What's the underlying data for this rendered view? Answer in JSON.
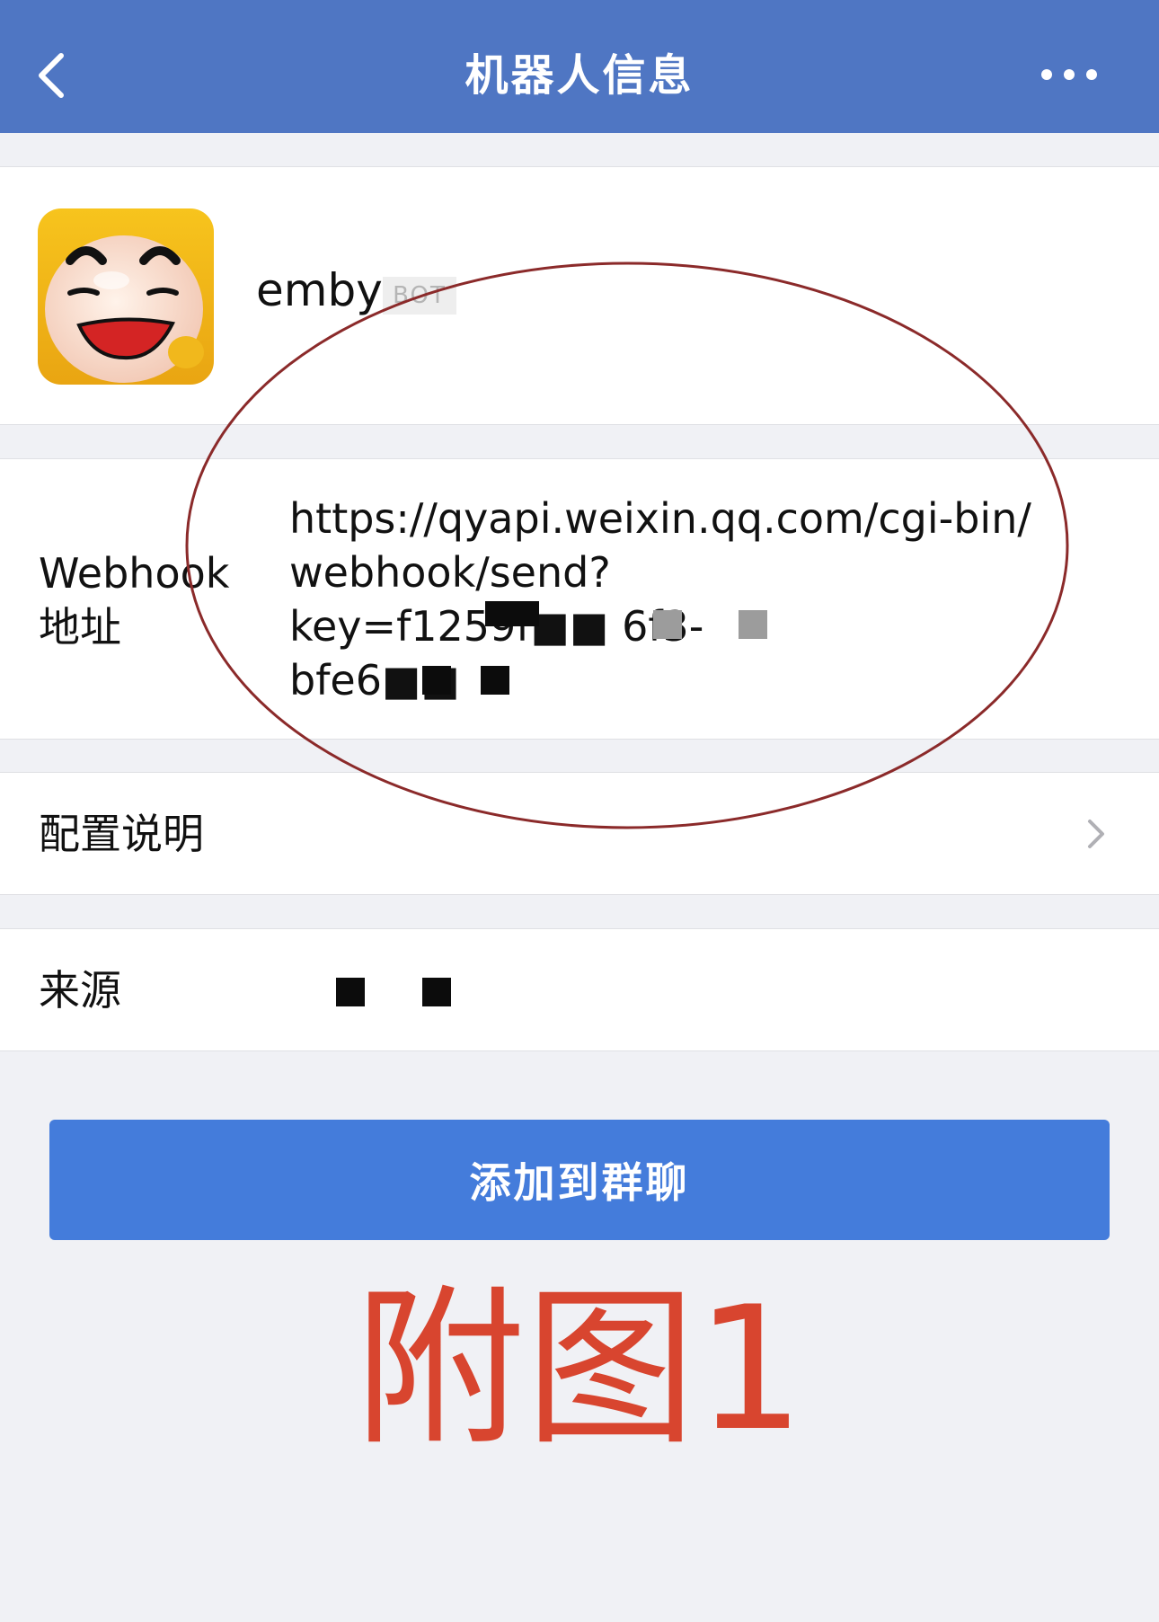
{
  "nav": {
    "title": "机器人信息",
    "back_icon": "chevron-left-icon",
    "more_icon": "more-dots-icon",
    "bar_color": "#4f76c3"
  },
  "profile": {
    "name": "emby",
    "badge": "BOT",
    "avatar_icon": "smiling-face-avatar"
  },
  "webhook": {
    "label": "Webhook\n地址",
    "value": "https://qyapi.weixin.qq.com/cgi-bin/\nwebhook/send?\nkey=f1259f■■ 6f3-\nbfe6■■"
  },
  "config": {
    "label": "配置说明",
    "chevron_icon": "chevron-right-icon"
  },
  "source": {
    "label": "来源",
    "value": "■ ■"
  },
  "actions": {
    "add_to_group_label": "添加到群聊",
    "button_color": "#447cdb"
  },
  "caption": {
    "text": "附图1",
    "color": "#d8452f"
  },
  "annotation": {
    "ellipse_color": "#8b2a2a"
  }
}
